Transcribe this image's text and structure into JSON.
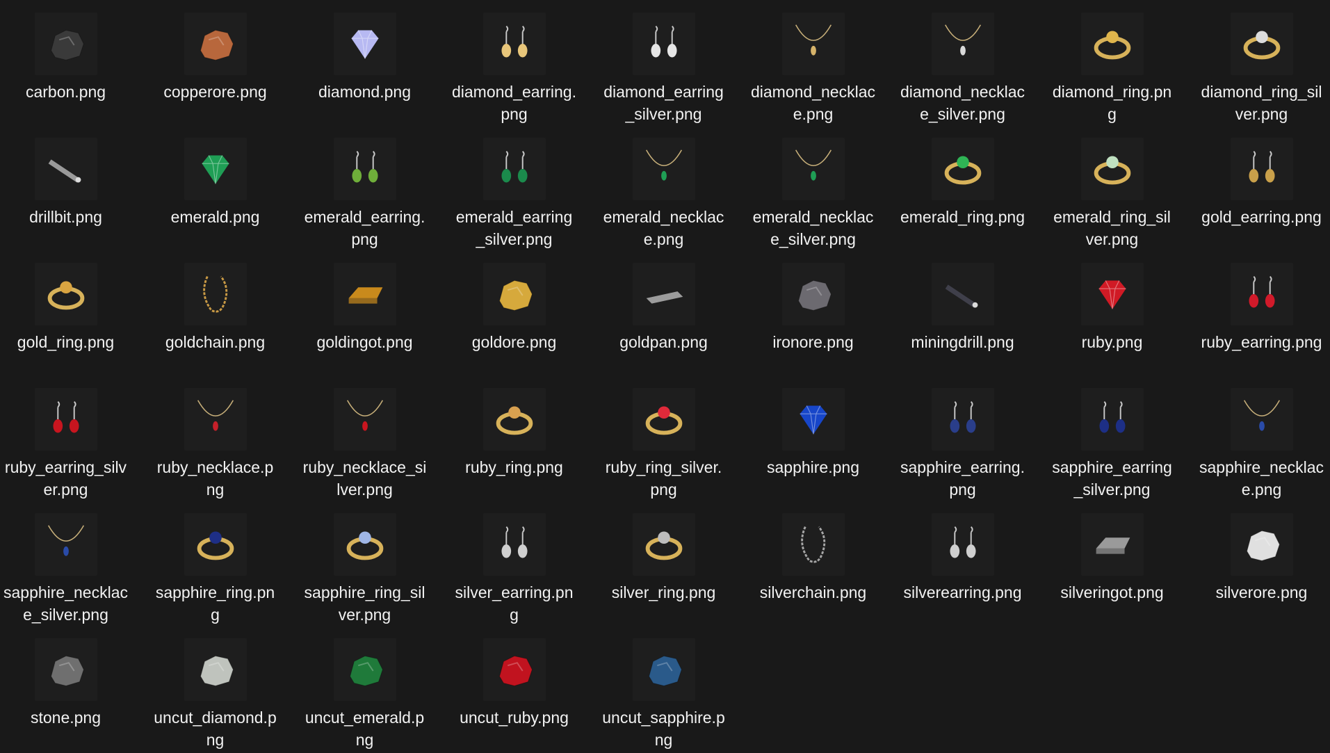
{
  "files": [
    {
      "name": "carbon.png",
      "icon": "carbon-lump-icon",
      "color": "#3a3a3a",
      "shape": "rock"
    },
    {
      "name": "copperore.png",
      "icon": "copper-ore-icon",
      "color": "#b8673c",
      "shape": "rock"
    },
    {
      "name": "diamond.png",
      "icon": "diamond-gem-icon",
      "color": "#b7b9f2",
      "shape": "gem"
    },
    {
      "name": "diamond_earring.png",
      "icon": "diamond-earring-icon",
      "color": "#e8c67a",
      "shape": "earring"
    },
    {
      "name": "diamond_earring_silver.png",
      "icon": "diamond-earring-silver-icon",
      "color": "#e6e6e6",
      "shape": "earring"
    },
    {
      "name": "diamond_necklace.png",
      "icon": "diamond-necklace-icon",
      "color": "#d6b36a",
      "shape": "necklace"
    },
    {
      "name": "diamond_necklace_silver.png",
      "icon": "diamond-necklace-silver-icon",
      "color": "#d9d9d9",
      "shape": "necklace"
    },
    {
      "name": "diamond_ring.png",
      "icon": "diamond-ring-icon",
      "color": "#e0b64c",
      "shape": "ring"
    },
    {
      "name": "diamond_ring_silver.png",
      "icon": "diamond-ring-silver-icon",
      "color": "#dcdcdc",
      "shape": "ring"
    },
    {
      "name": "drillbit.png",
      "icon": "drill-bit-icon",
      "color": "#9a9a9a",
      "shape": "bar"
    },
    {
      "name": "emerald.png",
      "icon": "emerald-gem-icon",
      "color": "#1f9e55",
      "shape": "gem"
    },
    {
      "name": "emerald_earring.png",
      "icon": "emerald-earring-icon",
      "color": "#6fae3a",
      "shape": "earring"
    },
    {
      "name": "emerald_earring_silver.png",
      "icon": "emerald-earring-silver-icon",
      "color": "#1b8a4c",
      "shape": "earring"
    },
    {
      "name": "emerald_necklace.png",
      "icon": "emerald-necklace-icon",
      "color": "#1f9e55",
      "shape": "necklace"
    },
    {
      "name": "emerald_necklace_silver.png",
      "icon": "emerald-necklace-silver-icon",
      "color": "#1f9e55",
      "shape": "necklace"
    },
    {
      "name": "emerald_ring.png",
      "icon": "emerald-ring-icon",
      "color": "#2fb455",
      "shape": "ring"
    },
    {
      "name": "emerald_ring_silver.png",
      "icon": "emerald-ring-silver-icon",
      "color": "#bfe0c0",
      "shape": "ring"
    },
    {
      "name": "gold_earring.png",
      "icon": "gold-earring-icon",
      "color": "#c9a04a",
      "shape": "earring"
    },
    {
      "name": "gold_ring.png",
      "icon": "gold-ring-icon",
      "color": "#d9a441",
      "shape": "ring"
    },
    {
      "name": "goldchain.png",
      "icon": "gold-chain-icon",
      "color": "#c99a45",
      "shape": "chain"
    },
    {
      "name": "goldingot.png",
      "icon": "gold-ingot-icon",
      "color": "#c98a1c",
      "shape": "ingot"
    },
    {
      "name": "goldore.png",
      "icon": "gold-ore-icon",
      "color": "#d6a93c",
      "shape": "rock"
    },
    {
      "name": "goldpan.png",
      "icon": "gold-pan-icon",
      "color": "#9c9c9c",
      "shape": "pan"
    },
    {
      "name": "ironore.png",
      "icon": "iron-ore-icon",
      "color": "#6c6a70",
      "shape": "rock"
    },
    {
      "name": "miningdrill.png",
      "icon": "mining-drill-icon",
      "color": "#3f3f4a",
      "shape": "bar"
    },
    {
      "name": "ruby.png",
      "icon": "ruby-gem-icon",
      "color": "#d01a25",
      "shape": "gem"
    },
    {
      "name": "ruby_earring.png",
      "icon": "ruby-earring-icon",
      "color": "#d11a2a",
      "shape": "earring"
    },
    {
      "name": "ruby_earring_silver.png",
      "icon": "ruby-earring-silver-icon",
      "color": "#c8151f",
      "shape": "earring"
    },
    {
      "name": "ruby_necklace.png",
      "icon": "ruby-necklace-icon",
      "color": "#c5202a",
      "shape": "necklace"
    },
    {
      "name": "ruby_necklace_silver.png",
      "icon": "ruby-necklace-silver-icon",
      "color": "#c8151f",
      "shape": "necklace"
    },
    {
      "name": "ruby_ring.png",
      "icon": "ruby-ring-icon",
      "color": "#d8a050",
      "shape": "ring"
    },
    {
      "name": "ruby_ring_silver.png",
      "icon": "ruby-ring-silver-icon",
      "color": "#e02a3a",
      "shape": "ring"
    },
    {
      "name": "sapphire.png",
      "icon": "sapphire-gem-icon",
      "color": "#1746c9",
      "shape": "gem"
    },
    {
      "name": "sapphire_earring.png",
      "icon": "sapphire-earring-icon",
      "color": "#2a3e8a",
      "shape": "earring"
    },
    {
      "name": "sapphire_earring_silver.png",
      "icon": "sapphire-earring-silver-icon",
      "color": "#1d2f86",
      "shape": "earring"
    },
    {
      "name": "sapphire_necklace.png",
      "icon": "sapphire-necklace-icon",
      "color": "#2a4ba8",
      "shape": "necklace"
    },
    {
      "name": "sapphire_necklace_silver.png",
      "icon": "sapphire-necklace-silver-icon",
      "color": "#2a4ba8",
      "shape": "necklace"
    },
    {
      "name": "sapphire_ring.png",
      "icon": "sapphire-ring-icon",
      "color": "#1e2f86",
      "shape": "ring"
    },
    {
      "name": "sapphire_ring_silver.png",
      "icon": "sapphire-ring-silver-icon",
      "color": "#9fb6e6",
      "shape": "ring"
    },
    {
      "name": "silver_earring.png",
      "icon": "silver-earring-icon",
      "color": "#cfcfcf",
      "shape": "earring"
    },
    {
      "name": "silver_ring.png",
      "icon": "silver-ring-icon",
      "color": "#bdbdbd",
      "shape": "ring"
    },
    {
      "name": "silverchain.png",
      "icon": "silver-chain-icon",
      "color": "#a5a5a5",
      "shape": "chain"
    },
    {
      "name": "silverearring.png",
      "icon": "silver-earring-alt-icon",
      "color": "#cfcfcf",
      "shape": "earring"
    },
    {
      "name": "silveringot.png",
      "icon": "silver-ingot-icon",
      "color": "#9a9a9a",
      "shape": "ingot"
    },
    {
      "name": "silverore.png",
      "icon": "silver-ore-icon",
      "color": "#e0e0e0",
      "shape": "rock"
    },
    {
      "name": "stone.png",
      "icon": "stone-icon",
      "color": "#6f6f6f",
      "shape": "rock"
    },
    {
      "name": "uncut_diamond.png",
      "icon": "uncut-diamond-icon",
      "color": "#bfc3bd",
      "shape": "rock"
    },
    {
      "name": "uncut_emerald.png",
      "icon": "uncut-emerald-icon",
      "color": "#1f7a3a",
      "shape": "rock"
    },
    {
      "name": "uncut_ruby.png",
      "icon": "uncut-ruby-icon",
      "color": "#c1131f",
      "shape": "rock"
    },
    {
      "name": "uncut_sapphire.png",
      "icon": "uncut-sapphire-icon",
      "color": "#2a5a8a",
      "shape": "rock"
    }
  ]
}
